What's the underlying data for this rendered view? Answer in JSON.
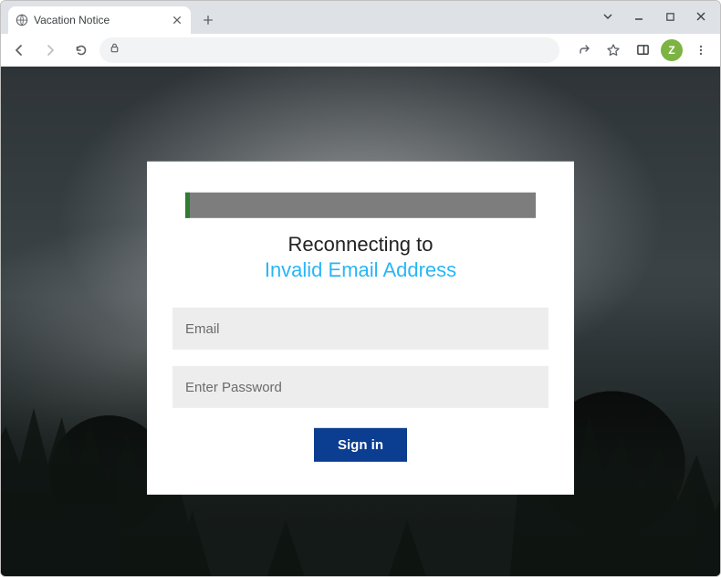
{
  "window": {
    "minimize_icon": "minimize",
    "maximize_icon": "maximize",
    "close_icon": "close",
    "dropdown_icon": "chevron-down"
  },
  "tab": {
    "title": "Vacation Notice",
    "favicon": "globe",
    "close_label": "×",
    "newtab_label": "+"
  },
  "toolbar": {
    "back_icon": "arrow-left",
    "forward_icon": "arrow-right",
    "reload_icon": "reload",
    "lock_icon": "lock",
    "url": "",
    "share_icon": "share",
    "star_icon": "star",
    "panel_icon": "panel",
    "menu_icon": "dots-vertical",
    "avatar_letter": "Z"
  },
  "login": {
    "heading": "Reconnecting to",
    "subheading": "Invalid Email Address",
    "email_placeholder": "Email",
    "password_placeholder": "Enter Password",
    "email_value": "",
    "password_value": "",
    "signin_label": "Sign in"
  }
}
